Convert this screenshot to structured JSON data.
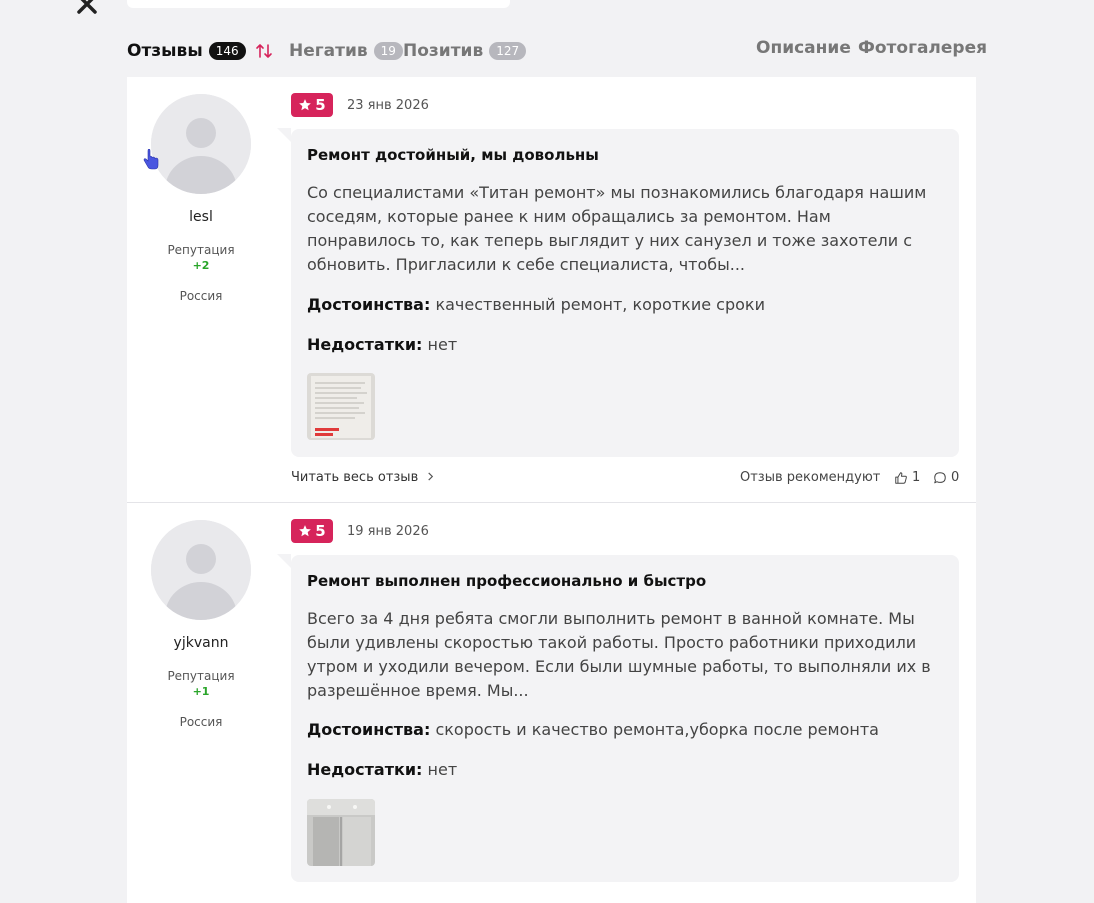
{
  "tabs": {
    "reviews_label": "Отзывы",
    "reviews_count": "146",
    "negative_label": "Негатив",
    "negative_count": "19",
    "positive_label": "Позитив",
    "positive_count": "127",
    "description_label": "Описание",
    "gallery_label": "Фотогалерея"
  },
  "reviews": [
    {
      "username": "lesl",
      "reputation_label": "Репутация",
      "reputation_value": "+2",
      "country": "Россия",
      "rating": "5",
      "date": "23 янв 2026",
      "title": "Ремонт достойный, мы довольны",
      "text": "Со специалистами «Титан ремонт» мы познакомились благодаря нашим соседям, которые ранее к ним обращались за ремонтом. Нам понравилось то, как теперь выглядит у них санузел и тоже захотели с обновить. Пригласили к себе специалиста, чтобы...",
      "pros_label": "Достоинства:",
      "pros": "качественный ремонт, короткие сроки",
      "cons_label": "Недостатки:",
      "cons": "нет",
      "read_more": "Читать весь отзыв",
      "recommend_label": "Отзыв рекомендуют",
      "likes": "1",
      "comments": "0"
    },
    {
      "username": "yjkvann",
      "reputation_label": "Репутация",
      "reputation_value": "+1",
      "country": "Россия",
      "rating": "5",
      "date": "19 янв 2026",
      "title": "Ремонт выполнен профессионально и быстро",
      "text": "Всего за 4 дня ребята смогли выполнить ремонт в ванной комнате. Мы были удивлены скоростью такой работы. Просто работники приходили утром и уходили вечером. Если были шумные работы, то выполняли их в разрешённое время. Мы...",
      "pros_label": "Достоинства:",
      "pros": "скорость и качество ремонта,уборка после ремонта",
      "cons_label": "Недостатки:",
      "cons": "нет"
    }
  ],
  "colors": {
    "accent": "#d6245b",
    "reputation": "#2aa52a",
    "active_badge": "#111111",
    "muted_badge": "#b7b7bd"
  }
}
